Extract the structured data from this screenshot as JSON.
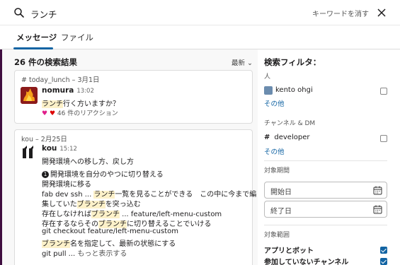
{
  "search": {
    "query": "ランチ"
  },
  "header": {
    "clear_label": "キーワードを消す"
  },
  "tabs": [
    {
      "label": "メッセージ"
    },
    {
      "label": "ファイル"
    }
  ],
  "results": {
    "count_label": "26 件の検索結果",
    "sort_label": "最新",
    "messages": [
      {
        "meta": "# today_lunch  –  3月1日",
        "author": "nomura",
        "time": "13:02",
        "lines": [
          {
            "hl": "ランチ",
            "rest": "行く方いますか？"
          }
        ],
        "reaction": "46 件のリアクション"
      },
      {
        "meta": "kou  –  2月25日",
        "author": "kou",
        "time": "15:12",
        "lines": [
          "開発環境への移し方、戻し方",
          "開発環境を自分のやつに切り替える",
          "開発環境に移る",
          {
            "a": "fab dev ssh ...  ",
            "hl": "ランチ",
            "b": "一覧を見ることができる　この中に今まで編"
          },
          {
            "a": "集していた",
            "hl": "ブランチ",
            "b": "を突っ込む"
          },
          {
            "a": "存在しなければ",
            "hl": "ブランチ",
            "b": " ...  feature/left-menu-custom"
          },
          {
            "a": "存在するならその",
            "hl": "ブランチ",
            "b": "に切り替えることでいける"
          },
          "git checkout feature/left-menu-custom",
          {
            "hl": "ブランチ",
            "b": "名を指定して、最新の状態にする"
          },
          {
            "a": "git pull ... ",
            "more": "もっと表示する"
          }
        ]
      }
    ]
  },
  "filters": {
    "title": "検索フィルタ：",
    "people_label": "人",
    "person": "kento ohgi",
    "people_more": "その他",
    "channel_label": "チャンネル & DM",
    "channel": "developer",
    "channel_more": "その他",
    "period_label": "対象期間",
    "start_placeholder": "開始日",
    "end_placeholder": "終了日",
    "scope_label": "対象範囲",
    "scope_items": [
      {
        "label": "アプリとボット",
        "checked": true
      },
      {
        "label": "参加していないチャンネル",
        "checked": true
      }
    ]
  }
}
